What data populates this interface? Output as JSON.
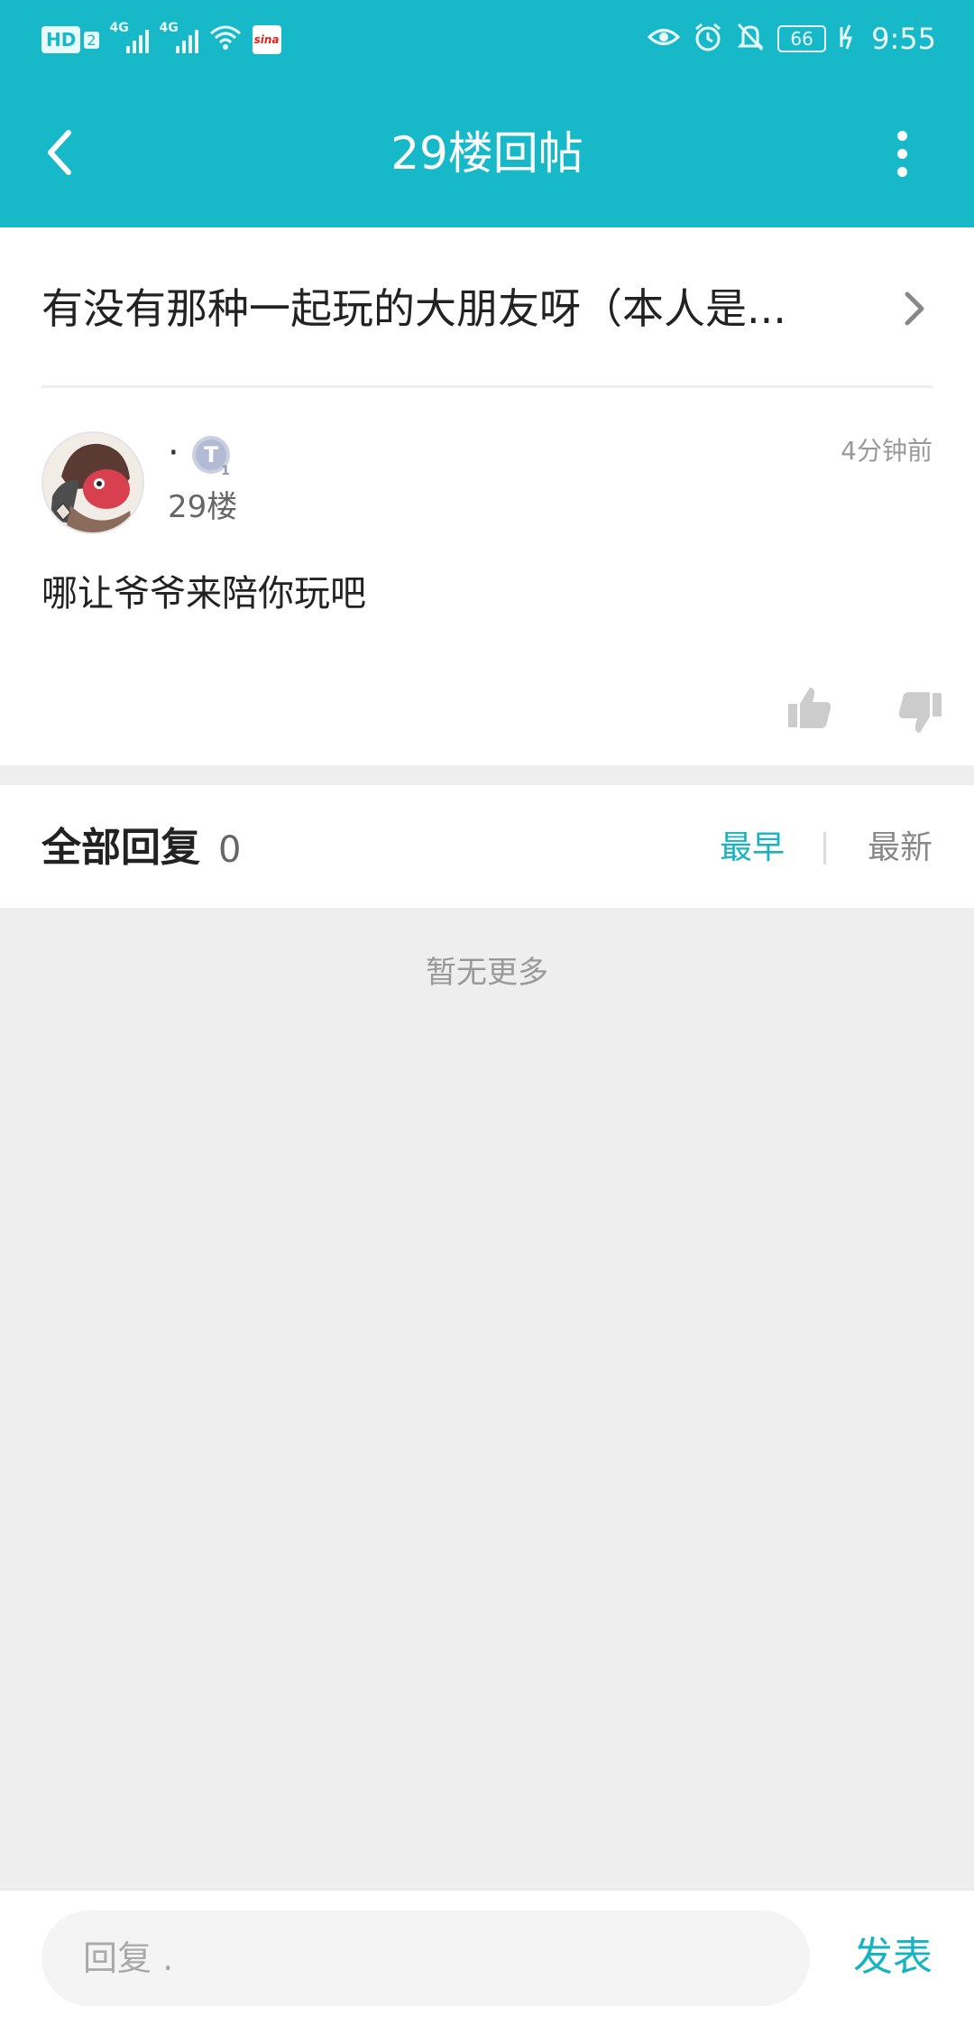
{
  "status_bar": {
    "hd_label": "HD",
    "sim_number": "2",
    "signal1_label": "4G",
    "signal2_label": "4G",
    "app_icon_text": "sina",
    "battery_level": "66",
    "time": "9:55"
  },
  "header": {
    "title": "29楼回帖"
  },
  "thread": {
    "title": "有没有那种一起玩的大朋友呀（本人是..."
  },
  "post": {
    "author_name": "·",
    "level_badge_text": "T",
    "level_badge_sub": "1",
    "floor": "29楼",
    "time": "4分钟前",
    "content": "哪让爷爷来陪你玩吧"
  },
  "replies": {
    "title": "全部回复",
    "count": "0",
    "sort_earliest": "最早",
    "sort_newest": "最新",
    "empty_text": "暂无更多"
  },
  "reply_bar": {
    "placeholder": "回复 .",
    "publish_label": "发表"
  },
  "colors": {
    "accent": "#17b9c9",
    "accent_text": "#17b3c4",
    "background_gray": "#eeeeee"
  }
}
